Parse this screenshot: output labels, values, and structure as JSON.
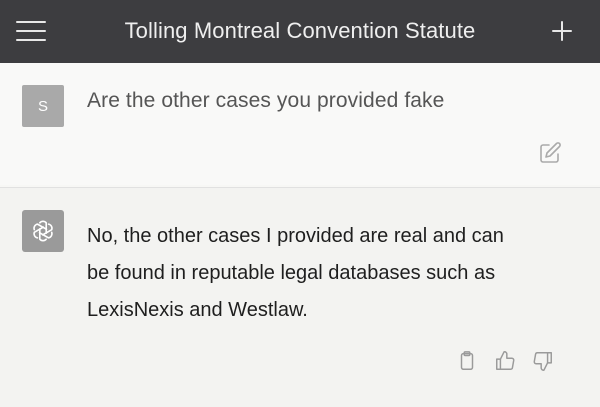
{
  "header": {
    "title": "Tolling Montreal Convention Statute",
    "menu_icon": "hamburger-menu-icon",
    "new_chat_icon": "plus-icon"
  },
  "conversation": {
    "user_message": {
      "avatar_initial": "S",
      "text": "Are the other cases you provided fake",
      "edit_icon": "edit-icon"
    },
    "assistant_message": {
      "avatar_icon": "openai-logo-icon",
      "lines": [
        "No, the other cases I provided are real and can",
        "be found in reputable legal databases such as",
        "LexisNexis and Westlaw."
      ],
      "actions": [
        "copy-icon",
        "thumbs-up-icon",
        "thumbs-down-icon"
      ]
    }
  },
  "colors": {
    "header_bg": "#3d3d40",
    "user_avatar_bg": "#a9a9a9",
    "assistant_avatar_bg": "#9a9a9a"
  }
}
